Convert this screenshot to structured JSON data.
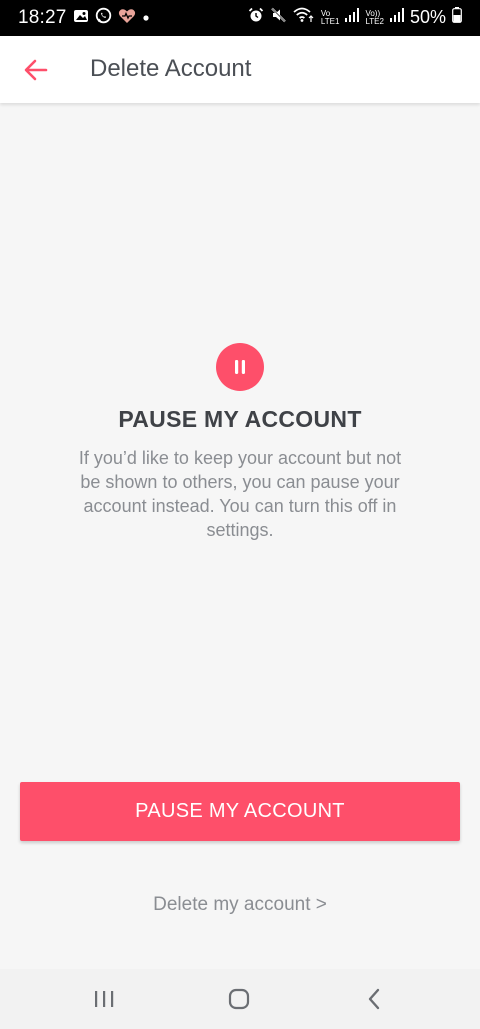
{
  "status_bar": {
    "time": "18:27",
    "signal_label_1_top": "Vo",
    "signal_label_1_bottom": "LTE1",
    "signal_label_2_top": "Vo))",
    "signal_label_2_bottom": "LTE2",
    "battery": "50%"
  },
  "header": {
    "title": "Delete Account"
  },
  "pause": {
    "title": "PAUSE MY ACCOUNT",
    "description": "If you’d like to keep your account but not be shown to others, you can pause your account instead. You can turn this off in settings.",
    "button_label": "PAUSE MY ACCOUNT"
  },
  "delete_link": "Delete my account >",
  "colors": {
    "accent": "#fe4f6a",
    "background": "#f6f6f6",
    "title_text": "#3f4247",
    "muted_text": "#8a8d92"
  },
  "icons": {
    "back": "arrow-left-icon",
    "pause": "pause-icon",
    "nav_recents": "recents-icon",
    "nav_home": "home-icon",
    "nav_back": "chevron-left-icon"
  }
}
